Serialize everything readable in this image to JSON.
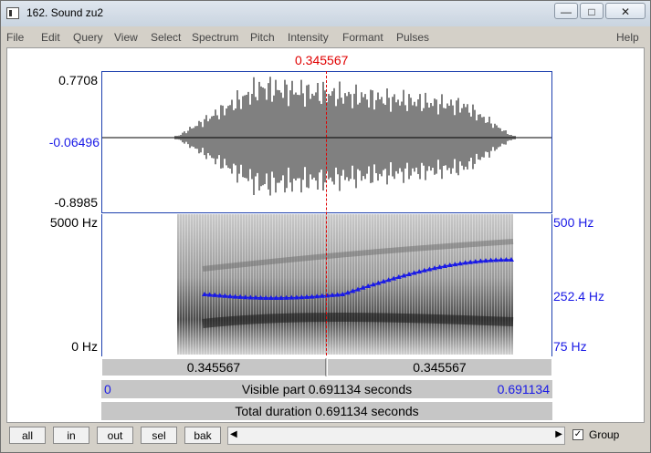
{
  "window": {
    "title": "162. Sound zu2"
  },
  "menu": [
    "File",
    "Edit",
    "Query",
    "View",
    "Select",
    "Spectrum",
    "Pitch",
    "Intensity",
    "Formant",
    "Pulses",
    "Help"
  ],
  "cursor": {
    "time_label": "0.345567"
  },
  "waveform": {
    "max_label": "0.7708",
    "zero_label": "-0.06496",
    "min_label": "-0.8985"
  },
  "spectrogram": {
    "top_freq": "5000 Hz",
    "bottom_freq": "0 Hz",
    "pitch_top": "500 Hz",
    "pitch_mid": "252.4 Hz",
    "pitch_bottom": "75 Hz"
  },
  "time_bar": {
    "left": "0.345567",
    "right": "0.345567"
  },
  "visible_bar": {
    "start": "0",
    "text": "Visible part 0.691134 seconds",
    "end": "0.691134"
  },
  "total_bar": {
    "text": "Total duration 0.691134 seconds"
  },
  "buttons": {
    "all": "all",
    "in": "in",
    "out": "out",
    "sel": "sel",
    "bak": "bak"
  },
  "group": {
    "label": "Group",
    "checked": true
  },
  "colors": {
    "pitch_track": "#1a1ae6",
    "cursor": "#e00000",
    "selection_bar": "#c6c6c6"
  }
}
